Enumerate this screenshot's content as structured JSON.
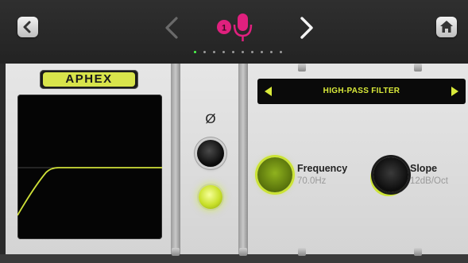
{
  "nav": {
    "back_icon": "chevron-left-icon",
    "home_icon": "home-icon",
    "prev_icon": "chevron-left-icon",
    "next_icon": "chevron-right-icon",
    "channel_icons": [
      "input-1-icon",
      "microphone-icon"
    ],
    "page_dots": {
      "count": 10,
      "active": 1
    }
  },
  "device": {
    "brand": "APHEX",
    "display_icon": "high-pass-curve-icon"
  },
  "phase": {
    "label": "Ø",
    "invert_icon": "phase-invert-button",
    "bypass_icon": "led-on-button"
  },
  "filter": {
    "type": "HIGH-PASS FILTER",
    "prev_icon": "triangle-left-icon",
    "next_icon": "triangle-right-icon"
  },
  "controls": {
    "frequency": {
      "label": "Frequency",
      "value": "70.0Hz"
    },
    "slope": {
      "label": "Slope",
      "value": "12dB/Oct"
    }
  },
  "colors": {
    "accent": "#d4e83a",
    "channel_magenta": "#e0207e",
    "panel": "#dcdcdc",
    "bar": "#252525"
  }
}
